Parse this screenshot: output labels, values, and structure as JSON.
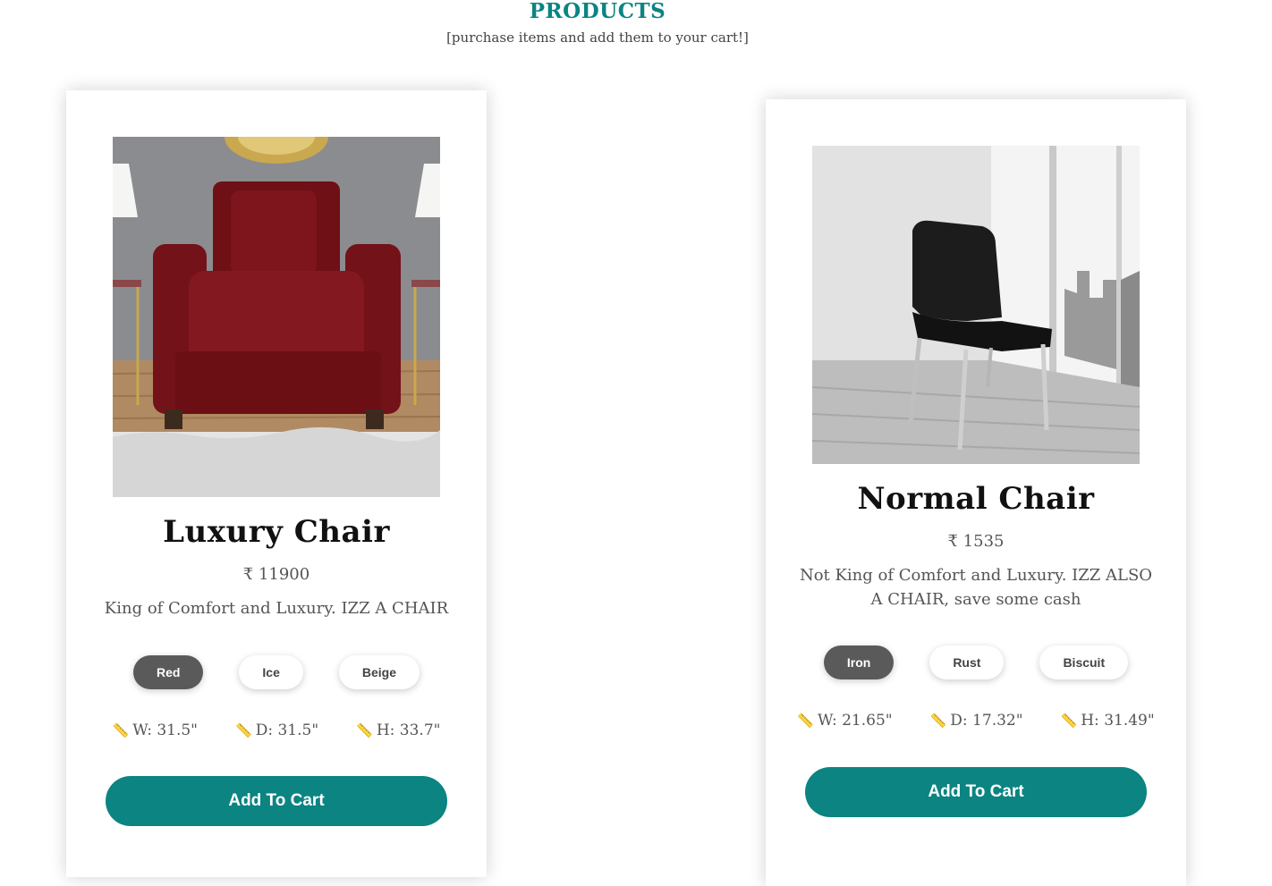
{
  "header": {
    "title": "PRODUCTS",
    "subtitle": "[purchase items and add them to your cart!]"
  },
  "colors": {
    "accent": "#0b8482",
    "chip_active": "#5a5a5a"
  },
  "currency_symbol": "₹",
  "products": [
    {
      "name": "Luxury Chair",
      "price": "₹ 11900",
      "description": "King of Comfort and Luxury. IZZ A CHAIR",
      "color_options": [
        "Red",
        "Ice",
        "Beige"
      ],
      "selected_color": "Red",
      "dimensions": {
        "w": "W: 31.5\"",
        "d": "D: 31.5\"",
        "h": "H: 33.7\""
      },
      "button_label": "Add To Cart"
    },
    {
      "name": "Normal Chair",
      "price": "₹ 1535",
      "description": "Not King of Comfort and Luxury. IZZ ALSO A CHAIR, save some cash",
      "color_options": [
        "Iron",
        "Rust",
        "Biscuit"
      ],
      "selected_color": "Iron",
      "dimensions": {
        "w": "W: 21.65\"",
        "d": "D: 17.32\"",
        "h": "H: 31.49\""
      },
      "button_label": "Add To Cart"
    }
  ]
}
